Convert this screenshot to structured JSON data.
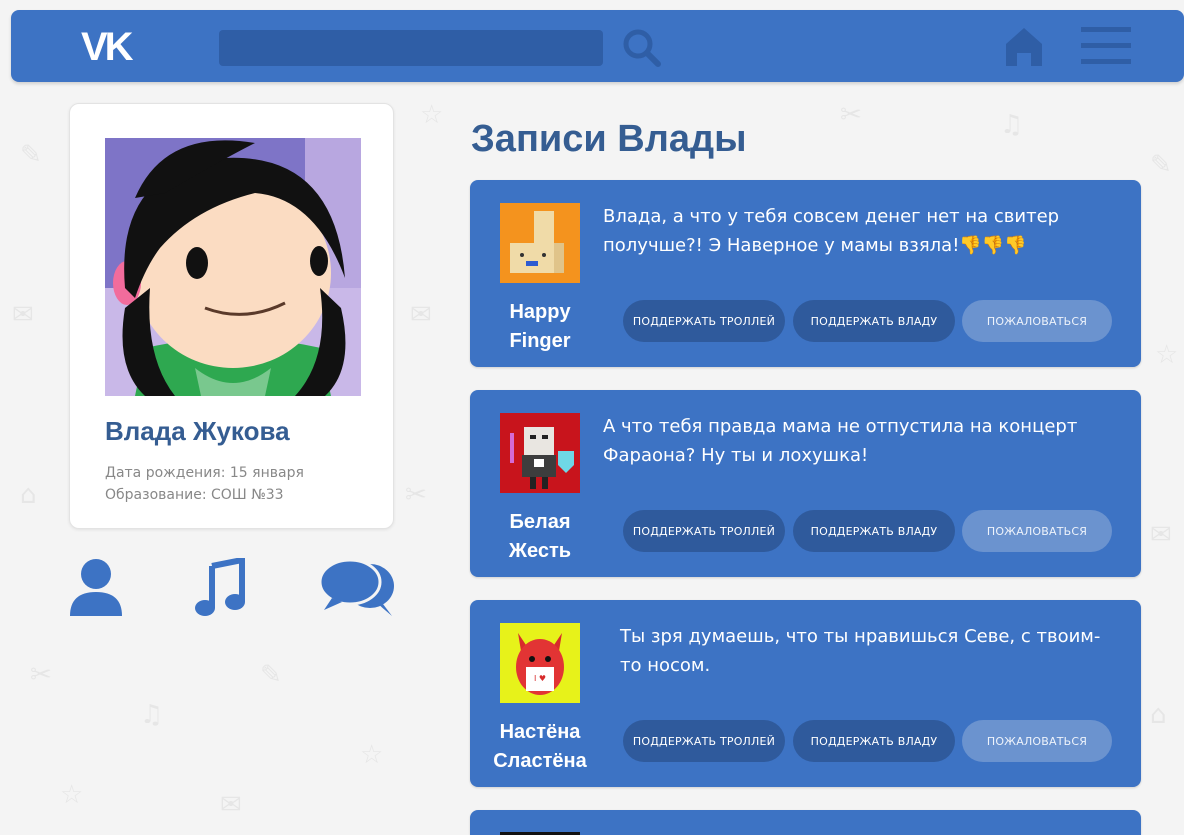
{
  "header": {
    "logo": "vk-logo",
    "search": {
      "value": "",
      "placeholder": ""
    }
  },
  "profile": {
    "name": "Влада Жукова",
    "birth": "Дата рождения: 15 января",
    "education": "Образование: СОШ №33"
  },
  "side_icons": [
    "user-icon",
    "music-icon",
    "messages-icon"
  ],
  "feed": {
    "title": "Записи Влады",
    "buttons": {
      "troll": "ПОДДЕРЖАТЬ ТРОЛЛЕЙ",
      "vlada": "ПОДДЕРЖАТЬ ВЛАДУ",
      "report": "ПОЖАЛОВАТЬСЯ"
    },
    "posts": [
      {
        "author_line1": "Happy",
        "author_line2": "Finger",
        "text": "Влада, а что у тебя совсем денег нет на свитер получше?! Э Наверное у мамы взяла!👎👎👎"
      },
      {
        "author_line1": "Белая",
        "author_line2": "Жесть",
        "text": "А что тебя правда мама не отпустила на концерт Фараона? Ну ты и лохушка!"
      },
      {
        "author_line1": "Настёна",
        "author_line2": "Сластёна",
        "text": "Ты зря думаешь, что ты нравишься Севе, с твоим-то носом."
      }
    ]
  },
  "colors": {
    "brand": "#3d73c4",
    "title": "#355d92",
    "button_dark": "#2f5a9c",
    "button_light": "#6b93cf"
  }
}
